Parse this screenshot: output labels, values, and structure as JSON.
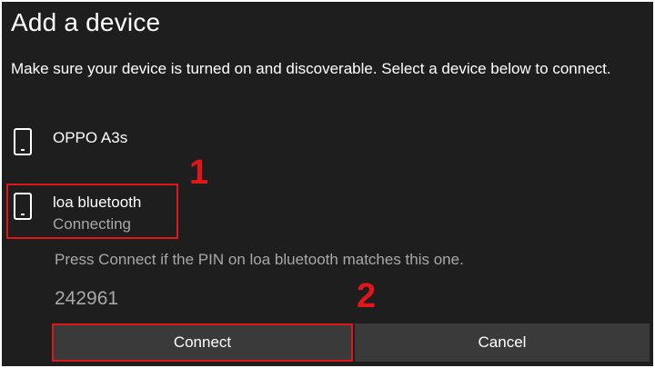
{
  "dialog": {
    "title": "Add a device",
    "instructions": "Make sure your device is turned on and discoverable. Select a device below to connect."
  },
  "devices": [
    {
      "name": "OPPO A3s",
      "icon": "phone-icon"
    },
    {
      "name": "loa bluetooth",
      "status": "Connecting",
      "icon": "phone-icon"
    }
  ],
  "pairing": {
    "message": "Press Connect if the PIN on loa bluetooth matches this one.",
    "pin": "242961"
  },
  "buttons": {
    "connect_label": "Connect",
    "cancel_label": "Cancel"
  },
  "annotations": {
    "marker_1": "1",
    "marker_2": "2"
  },
  "colors": {
    "background": "#1e1e1e",
    "button": "#3a3a3a",
    "annotation_red": "#e0161b",
    "secondary_text": "#a8a8a8"
  }
}
